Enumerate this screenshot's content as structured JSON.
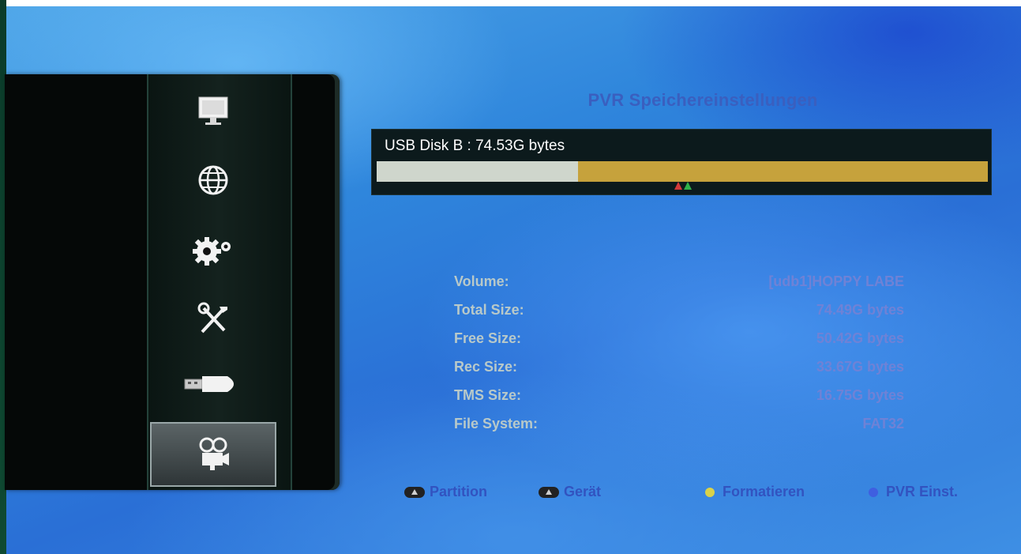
{
  "title": "PVR Speichereinstellungen",
  "disk": {
    "label": "USB Disk B : 74.53G bytes",
    "used_fraction": 0.33
  },
  "sidebar": {
    "items": [
      {
        "icon": "monitor-icon"
      },
      {
        "icon": "globe-icon"
      },
      {
        "icon": "gears-icon"
      },
      {
        "icon": "tools-icon"
      },
      {
        "icon": "usb-icon"
      },
      {
        "icon": "film-camera-icon",
        "active": true
      }
    ]
  },
  "info": [
    {
      "label": "Volume:",
      "value": "[udb1]HOPPY LABE"
    },
    {
      "label": "Total Size:",
      "value": "74.49G bytes"
    },
    {
      "label": "Free Size:",
      "value": "50.42G bytes"
    },
    {
      "label": "Rec Size:",
      "value": "33.67G bytes"
    },
    {
      "label": "TMS Size:",
      "value": "16.75G bytes"
    },
    {
      "label": "File System:",
      "value": "FAT32"
    }
  ],
  "footer": {
    "partition": "Partition",
    "device": "Gerät",
    "format": "Formatieren",
    "pvr": "PVR Einst."
  },
  "colors": {
    "yellow_key": "#d9d24a",
    "blue_key": "#3f5fe0",
    "bar_used": "#cfd6cc",
    "bar_free": "#c6a23c"
  }
}
